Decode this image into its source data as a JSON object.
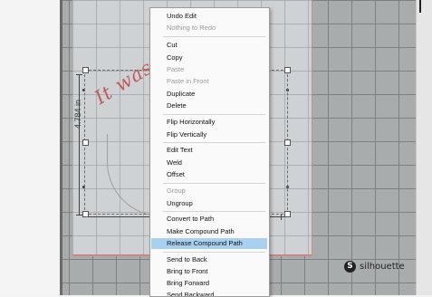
{
  "design": {
    "dimension_label": "4.784 in",
    "script_text": "It was"
  },
  "branding": {
    "logo_mark": "S",
    "logo_text": "silhouette"
  },
  "context_menu": {
    "items": [
      {
        "label": "Undo Edit",
        "enabled": true
      },
      {
        "label": "Nothing to Redo",
        "enabled": false
      },
      {
        "label": "Cut",
        "enabled": true
      },
      {
        "label": "Copy",
        "enabled": true
      },
      {
        "label": "Paste",
        "enabled": false
      },
      {
        "label": "Paste in Front",
        "enabled": false
      },
      {
        "label": "Duplicate",
        "enabled": true
      },
      {
        "label": "Delete",
        "enabled": true
      },
      {
        "label": "Flip Horizontally",
        "enabled": true
      },
      {
        "label": "Flip Vertically",
        "enabled": true
      },
      {
        "label": "Edit Text",
        "enabled": true
      },
      {
        "label": "Weld",
        "enabled": true
      },
      {
        "label": "Offset",
        "enabled": true
      },
      {
        "label": "Group",
        "enabled": false
      },
      {
        "label": "Ungroup",
        "enabled": true
      },
      {
        "label": "Convert to Path",
        "enabled": true
      },
      {
        "label": "Make Compound Path",
        "enabled": true
      },
      {
        "label": "Release Compound Path",
        "enabled": true,
        "highlighted": true
      },
      {
        "label": "Send to Back",
        "enabled": true
      },
      {
        "label": "Bring to Front",
        "enabled": true
      },
      {
        "label": "Bring Forward",
        "enabled": true
      },
      {
        "label": "Send Backward",
        "enabled": true
      }
    ]
  },
  "colors": {
    "highlight": "#aad0f0",
    "script_text": "#c25a5a",
    "mat_border": "#d08a8a"
  }
}
